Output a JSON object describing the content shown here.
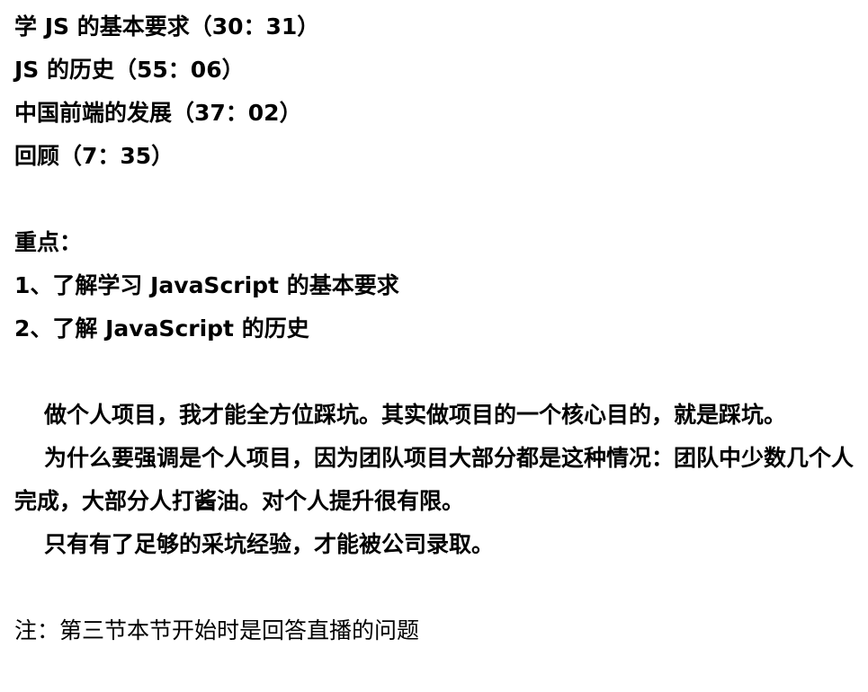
{
  "timeline": [
    "学 JS 的基本要求（30：31）",
    "JS 的历史（55：06）",
    "中国前端的发展（37：02）",
    "回顾（7：35）"
  ],
  "key_points": {
    "heading": "重点：",
    "items": [
      "1、了解学习 JavaScript 的基本要求",
      "2、了解 JavaScript 的历史"
    ]
  },
  "paragraphs": [
    "做个人项目，我才能全方位踩坑。其实做项目的一个核心目的，就是踩坑。",
    "为什么要强调是个人项目，因为团队项目大部分都是这种情况：团队中少数几个人完成，大部分人打酱油。对个人提升很有限。",
    "只有有了足够的采坑经验，才能被公司录取。"
  ],
  "note": "注：第三节本节开始时是回答直播的问题"
}
